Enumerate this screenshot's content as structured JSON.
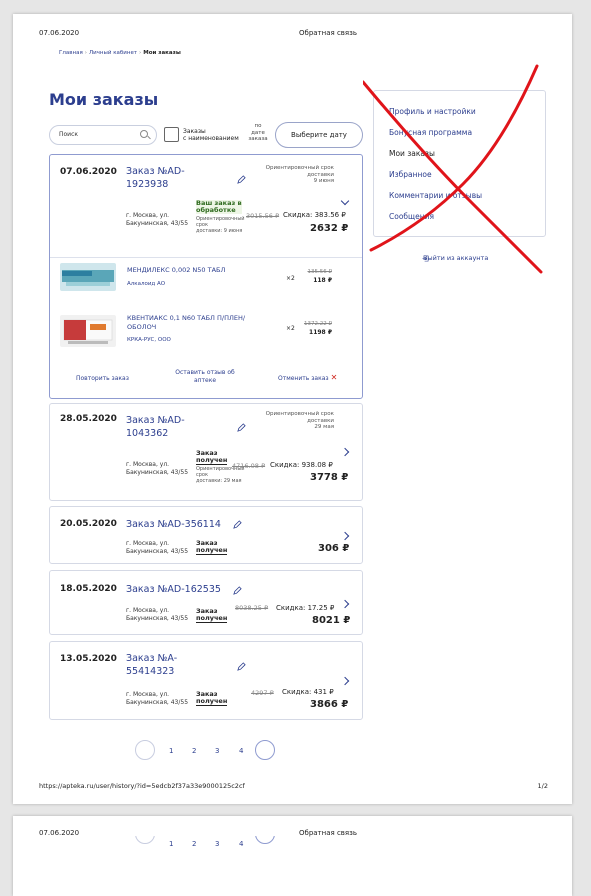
{
  "header": {
    "date": "07.06.2020",
    "title": "Обратная связь"
  },
  "footer": {
    "url": "https://apteka.ru/user/history/?id=5edcb2f37a33e9000125c2cf",
    "page": "1/2"
  },
  "breadcrumb": {
    "home": "Главная",
    "sep": "›",
    "account": "Личный кабинет",
    "current": "Мои заказы"
  },
  "page_title": "Мои заказы",
  "filters": {
    "search_placeholder": "Поиск",
    "checkbox_label_1": "Заказы",
    "checkbox_label_2": "с наименованием",
    "by_date_1": "по",
    "by_date_2": "дате",
    "by_date_3": "заказа",
    "date_button": "Выберите дату"
  },
  "orders": [
    {
      "date": "07.06.2020",
      "number_1": "Заказ №AD-",
      "number_2": "1923938",
      "eta_1": "Ориентировочный срок",
      "eta_2": "доставки",
      "eta_3": "9 июня",
      "address_1": "г. Москва, ул.",
      "address_2": "Бакунинская, 43/55",
      "status_1": "Ваш заказ в",
      "status_2": "обработке",
      "sub_1": "Ориентировочный",
      "sub_2": "срок",
      "sub_3": "доставки: 9 июня",
      "old_price": "3015.56 ₽",
      "discount": "Скидка: 383.56 ₽",
      "total": "2632 ₽",
      "products": [
        {
          "name": "МЕНДИЛЕКС 0,002 N50 ТАБЛ",
          "maker": "Алкалоид АО",
          "qty": "×2",
          "old": "135.56 ₽",
          "price": "118 ₽"
        },
        {
          "name_1": "КВЕНТИАКС 0,1 N60 ТАБЛ П/ПЛЕН/",
          "name_2": "ОБОЛОЧ",
          "maker": "КРКА-РУС, ООО",
          "qty": "×2",
          "old": "1372.22 ₽",
          "price": "1198 ₽"
        }
      ],
      "actions": {
        "repeat": "Повторить заказ",
        "review_1": "Оставить отзыв об",
        "review_2": "аптеке",
        "cancel": "Отменить заказ",
        "cancel_icon": "✕"
      }
    },
    {
      "date": "28.05.2020",
      "number_1": "Заказ №AD-",
      "number_2": "1043362",
      "eta_1": "Ориентировочный срок",
      "eta_2": "доставки",
      "eta_3": "29 мая",
      "address_1": "г. Москва, ул.",
      "address_2": "Бакунинская, 43/55",
      "status_1": "Заказ",
      "status_2": "получен",
      "sub_1": "Ориентировочный",
      "sub_2": "срок",
      "sub_3": "доставки: 29 мая",
      "old_price": "4716.08 ₽",
      "discount": "Скидка: 938.08 ₽",
      "total": "3778 ₽"
    },
    {
      "date": "20.05.2020",
      "number": "Заказ №AD-356114",
      "address_1": "г. Москва, ул.",
      "address_2": "Бакунинская, 43/55",
      "status_1": "Заказ",
      "status_2": "получен",
      "total": "306 ₽"
    },
    {
      "date": "18.05.2020",
      "number": "Заказ №AD-162535",
      "address_1": "г. Москва, ул.",
      "address_2": "Бакунинская, 43/55",
      "status_1": "Заказ",
      "status_2": "получен",
      "old_price": "8038.25 ₽",
      "discount": "Скидка: 17.25 ₽",
      "total": "8021 ₽"
    },
    {
      "date": "13.05.2020",
      "number_1": "Заказ №A-",
      "number_2": "55414323",
      "address_1": "г. Москва, ул.",
      "address_2": "Бакунинская, 43/55",
      "status_1": "Заказ",
      "status_2": "получен",
      "old_price": "4297 ₽",
      "discount": "Скидка: 431 ₽",
      "total": "3866 ₽"
    }
  ],
  "pagination": {
    "pages": [
      "1",
      "2",
      "3",
      "4"
    ]
  },
  "sidebar": {
    "items": [
      "Профиль и настройки",
      "Бонусная программа",
      "Мои заказы",
      "Избранное",
      "Комментарии и отзывы",
      "Сообщения"
    ],
    "logout": "Выйти из аккаунта"
  },
  "colors": {
    "brand": "#2c3e8e",
    "annotation": "#e0141a",
    "cancel": "#d0281f"
  }
}
